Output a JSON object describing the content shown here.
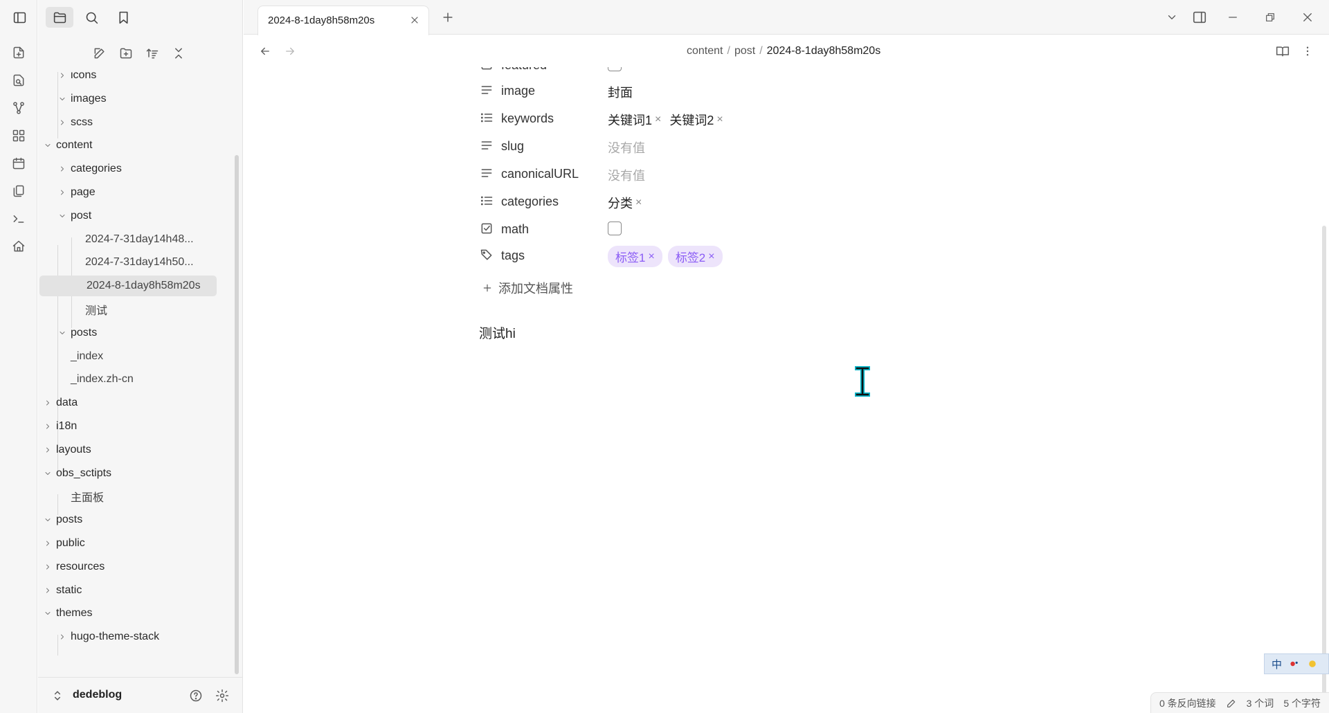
{
  "sidebar_top": {
    "icons": [
      "sidebar-toggle-icon",
      "folder-icon",
      "search-icon",
      "bookmark-icon"
    ]
  },
  "ribbon": {
    "icons": [
      "new-note-icon",
      "switcher-icon",
      "graph-icon",
      "canvas-icon",
      "calendar-icon",
      "templates-icon",
      "terminal-icon",
      "home-icon"
    ]
  },
  "tree": [
    {
      "label": "icons",
      "type": "folder",
      "open": false
    },
    {
      "label": "images",
      "type": "folder",
      "open": true
    },
    {
      "label": "scss",
      "type": "folder",
      "open": false
    },
    {
      "label": "content",
      "type": "folder",
      "open": true
    },
    {
      "label": "categories",
      "type": "folder",
      "open": false
    },
    {
      "label": "page",
      "type": "folder",
      "open": false
    },
    {
      "label": "post",
      "type": "folder",
      "open": true
    },
    {
      "label": "2024-7-31day14h48...",
      "type": "file"
    },
    {
      "label": "2024-7-31day14h50...",
      "type": "file"
    },
    {
      "label": "2024-8-1day8h58m20s",
      "type": "file",
      "selected": true
    },
    {
      "label": "测试",
      "type": "file"
    },
    {
      "label": "posts",
      "type": "folder",
      "open": true
    },
    {
      "label": "_index",
      "type": "file"
    },
    {
      "label": "_index.zh-cn",
      "type": "file"
    },
    {
      "label": "data",
      "type": "folder",
      "open": false
    },
    {
      "label": "i18n",
      "type": "folder",
      "open": false
    },
    {
      "label": "layouts",
      "type": "folder",
      "open": false
    },
    {
      "label": "obs_sctipts",
      "type": "folder",
      "open": true
    },
    {
      "label": "主面板",
      "type": "file"
    },
    {
      "label": "posts",
      "type": "folder",
      "open": true
    },
    {
      "label": "public",
      "type": "folder",
      "open": false
    },
    {
      "label": "resources",
      "type": "folder",
      "open": false
    },
    {
      "label": "static",
      "type": "folder",
      "open": false
    },
    {
      "label": "themes",
      "type": "folder",
      "open": true
    },
    {
      "label": "hugo-theme-stack",
      "type": "folder",
      "open": false
    }
  ],
  "vault": {
    "name": "dedeblog"
  },
  "tab": {
    "title": "2024-8-1day8h58m20s"
  },
  "breadcrumb": {
    "p1": "content",
    "p2": "post",
    "current": "2024-8-1day8h58m20s",
    "sep": "/"
  },
  "properties": {
    "partial_key": "featured",
    "image": {
      "key": "image",
      "value": "封面"
    },
    "keywords": {
      "key": "keywords",
      "values": [
        "关键词1",
        "关键词2"
      ]
    },
    "slug": {
      "key": "slug",
      "empty": "没有值"
    },
    "canonicalURL": {
      "key": "canonicalURL",
      "empty": "没有值"
    },
    "categories": {
      "key": "categories",
      "values": [
        "分类"
      ]
    },
    "math": {
      "key": "math",
      "checked": false
    },
    "tags": {
      "key": "tags",
      "values": [
        "标签1",
        "标签2"
      ]
    },
    "remove_glyph": "×",
    "add_label": "添加文档属性"
  },
  "body": {
    "text": "测试hi"
  },
  "status": {
    "backlinks": "0 条反向链接",
    "words": "3 个词",
    "chars": "5 个字符"
  },
  "ime": {
    "label": "中"
  },
  "colors": {
    "accent": "#8a5cf5",
    "tag_bg": "#ede4fb",
    "sidebar_bg": "#f6f6f6",
    "selected_bg": "#e3e3e3"
  }
}
